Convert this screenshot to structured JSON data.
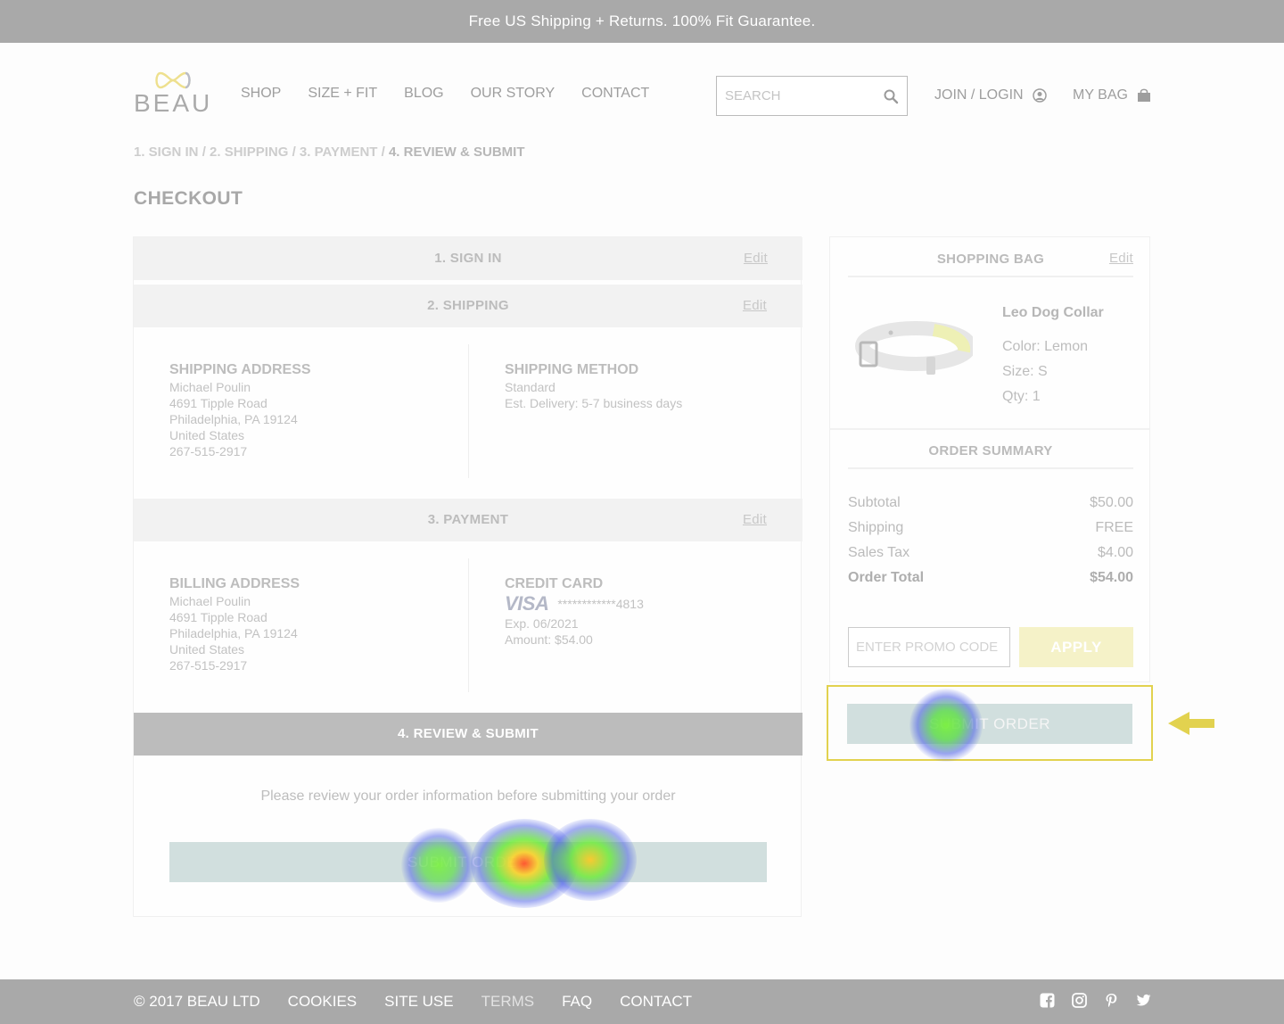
{
  "banner": {
    "text": "Free US Shipping + Returns. 100% Fit Guarantee."
  },
  "header": {
    "logo_text": "BEAU",
    "nav": [
      "SHOP",
      "SIZE + FIT",
      "BLOG",
      "OUR STORY",
      "CONTACT"
    ],
    "search_placeholder": "SEARCH",
    "join_label": "JOIN / LOGIN",
    "bag_label": "MY BAG"
  },
  "breadcrumb": {
    "steps": [
      "1. SIGN IN",
      "2. SHIPPING",
      "3. PAYMENT"
    ],
    "current": "4. REVIEW & SUBMIT",
    "separator": " / "
  },
  "page_title": "CHECKOUT",
  "checkout": {
    "edit_label": "Edit",
    "sign_in_title": "1. SIGN IN",
    "shipping_title": "2. SHIPPING",
    "shipping_address": {
      "title": "SHIPPING ADDRESS",
      "lines": [
        "Michael Poulin",
        "4691 Tipple Road",
        "Philadelphia, PA 19124",
        "United States",
        "267-515-2917"
      ]
    },
    "shipping_method": {
      "title": "SHIPPING METHOD",
      "lines": [
        "Standard",
        "Est. Delivery: 5-7 business days"
      ]
    },
    "payment_title": "3. PAYMENT",
    "billing_address": {
      "title": "BILLING ADDRESS",
      "lines": [
        "Michael Poulin",
        "4691 Tipple Road",
        "Philadelphia, PA 19124",
        "United States",
        "267-515-2917"
      ]
    },
    "credit_card": {
      "title": "CREDIT CARD",
      "brand": "VISA",
      "number": "************4813",
      "exp": "Exp. 06/2021",
      "amount": "Amount: $54.00"
    },
    "review_title": "4. REVIEW & SUBMIT",
    "review_text": "Please review your order information before submitting your order",
    "submit_label": "SUBMIT ORDER"
  },
  "bag": {
    "title": "SHOPPING BAG",
    "edit_label": "Edit",
    "product": {
      "name": "Leo Dog Collar",
      "color": "Color: Lemon",
      "size": "Size: S",
      "qty": "Qty: 1"
    }
  },
  "summary": {
    "title": "ORDER SUMMARY",
    "rows": [
      {
        "label": "Subtotal",
        "value": "$50.00"
      },
      {
        "label": "Shipping",
        "value": "FREE"
      },
      {
        "label": "Sales Tax",
        "value": "$4.00"
      },
      {
        "label": "Order Total",
        "value": "$54.00"
      }
    ],
    "promo_placeholder": "ENTER PROMO CODE",
    "apply_label": "APPLY",
    "submit_label": "SUBMIT ORDER"
  },
  "footer": {
    "links": [
      "© 2017 BEAU LTD",
      "COOKIES",
      "SITE USE",
      "TERMS",
      "FAQ",
      "CONTACT"
    ],
    "social_icons": [
      "facebook-icon",
      "instagram-icon",
      "pinterest-icon",
      "twitter-icon"
    ]
  },
  "colors": {
    "accent_yellow": "#e2d24f",
    "button_teal": "#d1dfde",
    "bar_gray": "#a9a9a9"
  }
}
